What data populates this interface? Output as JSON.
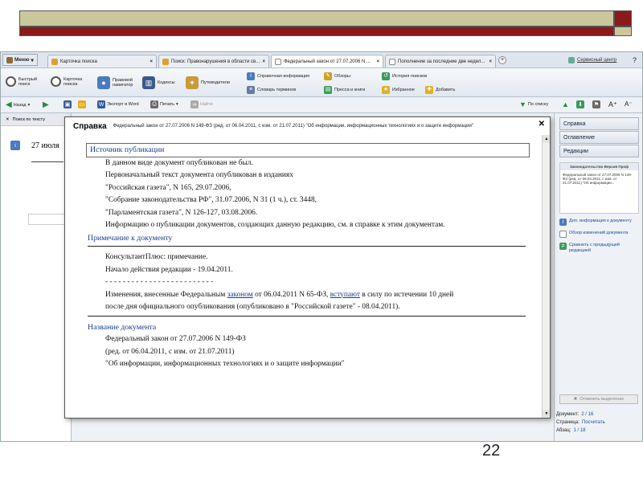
{
  "app": {
    "menu_label": "Меню",
    "tabs": [
      {
        "label": "Карточка поиска"
      },
      {
        "label": "Поиск: Правонарушения в области св..."
      },
      {
        "label": "Федеральный закон от 27.07.2006 N ..."
      },
      {
        "label": "Пополнение за последние две недел..."
      }
    ],
    "service_link": "Сервисный центр"
  },
  "toolbar1": {
    "buttons": [
      "Быстрый поиск",
      "Карточка поиска",
      "Правовой навигатор",
      "Кодексы",
      "Путеводители"
    ],
    "links": [
      "Справочная информация",
      "Обзоры",
      "История поисков",
      "Словарь терминов",
      "Пресса и книги",
      "Избранное",
      "Добавить"
    ]
  },
  "toolbar2": {
    "back": "Назад",
    "export": "Экспорт в Word",
    "print": "Печать",
    "find": "Найти",
    "to_list": "По списку"
  },
  "left_pane": {
    "header": "Поиск по тексту",
    "date_fragment": "27 июля"
  },
  "right_pane": {
    "buttons": [
      "Справка",
      "Оглавление",
      "Редакции"
    ],
    "box_title": "Законодательство Версия Проф",
    "box_text": "Федеральный закон от 27.07.2006 N 149-ФЗ (ред. от 06.04.2011, с изм. от 21.07.2011) \"Об информации...",
    "links": [
      "Доп. информация к документу",
      "Обзор изменений документа",
      "Сравнить с предыдущей редакцией"
    ],
    "clear_btn": "Отменить выделение",
    "doc_label": "Документ:",
    "doc_value": "2 / 16",
    "page_label": "Страница:",
    "page_value": "Посчитать",
    "para_label": "Абзац:",
    "para_value": "1 / 18"
  },
  "dialog": {
    "title": "Справка",
    "subtitle": "Федеральный закон от 27.07.2006 N 149-ФЗ (ред. от 06.04.2011, с изм. от 21.07.2011) \"Об информации, информационных технологиях и о защите информации\"",
    "sec1_title": "Источник публикации",
    "sec1_lines": [
      "В данном виде документ опубликован не был.",
      "Первоначальный текст документа опубликован в изданиях",
      "\"Российская газета\", N 165, 29.07.2006,",
      "\"Собрание законодательства РФ\", 31.07.2006, N 31 (1 ч.), ст. 3448,",
      "\"Парламентская газета\", N 126-127, 03.08.2006.",
      "Информацию о публикации документов, создающих данную редакцию, см. в справке к этим документам."
    ],
    "sec2_title": "Примечание к документу",
    "sec2_lines": [
      "КонсультантПлюс: примечание.",
      "Начало действия редакции - 19.04.2011.",
      "- - - - - - - - - - - - - - - - - - - - - - - - -"
    ],
    "sec2_change_a": "Изменения, внесенные Федеральным ",
    "sec2_link1": "законом",
    "sec2_change_b": " от 06.04.2011 N 65-ФЗ, ",
    "sec2_link2": "вступают",
    "sec2_change_c": " в силу по истечении 10 дней",
    "sec2_change_d": "после дня официального опубликования (опубликовано в \"Российской газете\" - 08.04.2011).",
    "sec3_title": "Название документа",
    "sec3_lines": [
      "Федеральный закон от 27.07.2006 N 149-ФЗ",
      "(ред. от 06.04.2011, с изм. от 21.07.2011)",
      "\"Об информации, информационных технологиях и о защите информации\""
    ]
  },
  "slide_number": "22"
}
